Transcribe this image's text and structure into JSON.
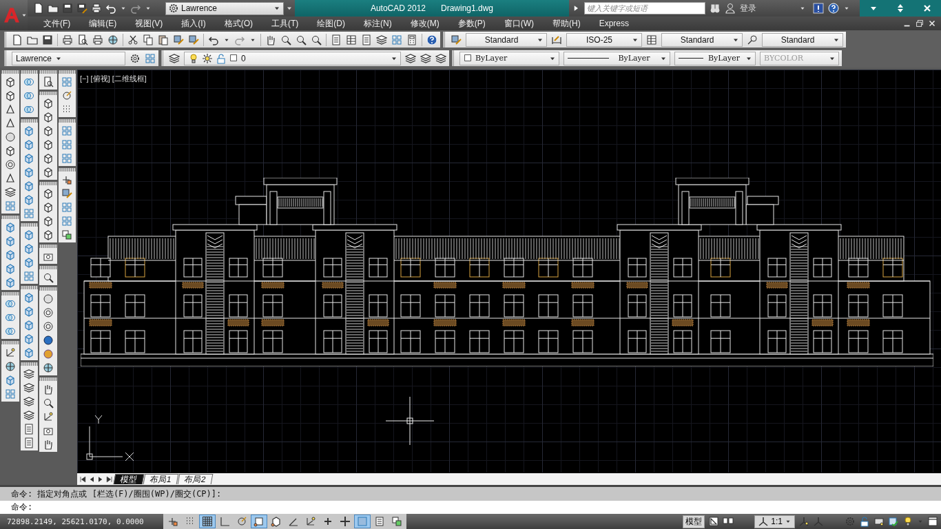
{
  "title_bar": {
    "workspace": "Lawrence",
    "app_name": "AutoCAD 2012",
    "file_name": "Drawing1.dwg",
    "search": {
      "placeholder": "键入关键字或短语"
    },
    "login": "登录"
  },
  "menu": [
    "文件(F)",
    "编辑(E)",
    "视图(V)",
    "插入(I)",
    "格式(O)",
    "工具(T)",
    "绘图(D)",
    "标注(N)",
    "修改(M)",
    "参数(P)",
    "窗口(W)",
    "帮助(H)",
    "Express"
  ],
  "styles_toolbar": {
    "text_style": "Standard",
    "dim_style": "ISO-25",
    "table_style": "Standard",
    "multileader_style": "Standard"
  },
  "layers_toolbar": {
    "workspace": "Lawrence",
    "layer": "0",
    "color_setting": "ByLayer",
    "linetype": "ByLayer",
    "lineweight": "ByLayer",
    "plot_style": {
      "value": "BYCOLOR",
      "disabled": true
    }
  },
  "viewport_label": "[−] [俯视] [二维线框]",
  "layout_tabs": [
    {
      "label": "模型",
      "selected": true
    },
    {
      "label": "布局1",
      "selected": false
    },
    {
      "label": "布局2",
      "selected": false
    }
  ],
  "command_history": [
    "命令: 指定对角点或 [栏选(F)/圈围(WP)/圈交(CP)]:"
  ],
  "command_prompt": "命令:",
  "status_bar": {
    "coordinates": "72898.2149, 25621.0170, 0.0000",
    "toggles": [
      {
        "kind": "snap",
        "on": false
      },
      {
        "kind": "dots",
        "on": false
      },
      {
        "kind": "grid",
        "on": true
      },
      {
        "kind": "ortho",
        "on": false
      },
      {
        "kind": "polar",
        "on": false
      },
      {
        "kind": "osnap",
        "on": true
      },
      {
        "kind": "osnap3d",
        "on": false
      },
      {
        "kind": "angle",
        "on": false
      },
      {
        "kind": "ducs",
        "on": false
      },
      {
        "kind": "plus",
        "on": false
      },
      {
        "kind": "cross",
        "on": false
      },
      {
        "kind": "hatch",
        "on": true
      },
      {
        "kind": "props",
        "on": false
      },
      {
        "kind": "cycle",
        "on": false
      }
    ],
    "space": "模型",
    "annotation_scale": "1:1"
  }
}
